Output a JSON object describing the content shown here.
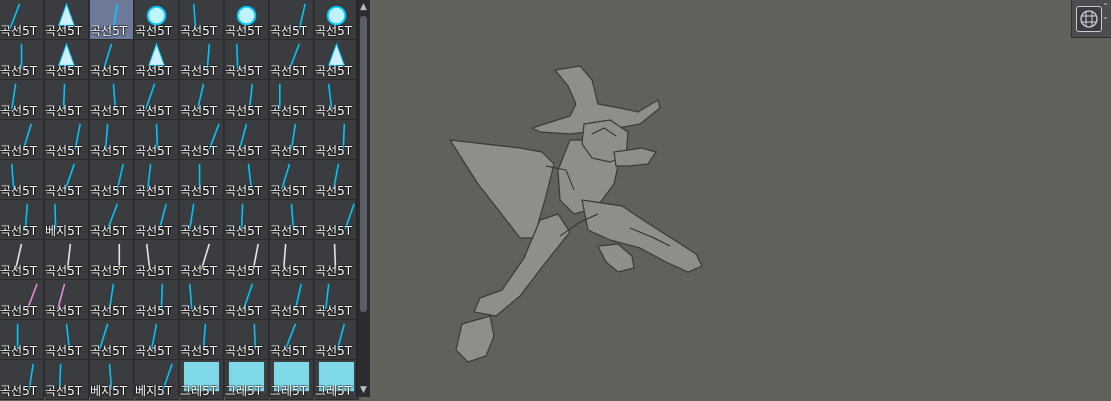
{
  "brush_panel": {
    "labels": [
      "곡선5T",
      "곡선5T",
      "곡선5T",
      "곡선5T",
      "곡선5T",
      "곡선5T",
      "곡선5T",
      "곡선5T",
      "곡선5T",
      "곡선5T",
      "곡선5T",
      "곡선5T",
      "곡선5T",
      "곡선5T",
      "곡선5T",
      "곡선5T",
      "곡선5T",
      "곡선5T",
      "곡선5T",
      "곡선5T",
      "곡선5T",
      "곡선5T",
      "곡선5T",
      "곡선5T",
      "곡선5T",
      "곡선5T",
      "곡선5T",
      "곡선5T",
      "곡선5T",
      "곡선5T",
      "곡선5T",
      "곡선5T",
      "곡선5T",
      "곡선5T",
      "곡선5T",
      "곡선5T",
      "곡선5T",
      "곡선5T",
      "곡선5T",
      "곡선5T",
      "곡선5T",
      "베지5T",
      "곡선5T",
      "곡선5T",
      "곡선5T",
      "곡선5T",
      "곡선5T",
      "곡선5T",
      "곡선5T",
      "곡선5T",
      "곡선5T",
      "곡선5T",
      "곡선5T",
      "곡선5T",
      "곡선5T",
      "곡선5T",
      "곡선5T",
      "곡선5T",
      "곡선5T",
      "곡선5T",
      "곡선5T",
      "곡선5T",
      "곡선5T",
      "곡선5T",
      "곡선5T",
      "곡선5T",
      "곡선5T",
      "곡선5T",
      "곡선5T",
      "곡선5T",
      "곡선5T",
      "곡선5T",
      "곡선5T",
      "곡선5T",
      "베지5T",
      "베지5T",
      "그레5T",
      "그레5T",
      "그레5T",
      "그레5T"
    ],
    "selected_index": 2,
    "accent_color": "#00c8ff"
  },
  "scrollbar": {
    "up_icon": "arrow-up-icon",
    "down_icon": "arrow-down-icon"
  },
  "canvas": {
    "background_color": "#5f625a"
  },
  "toolbar": {
    "icon": "grid-view-icon"
  }
}
